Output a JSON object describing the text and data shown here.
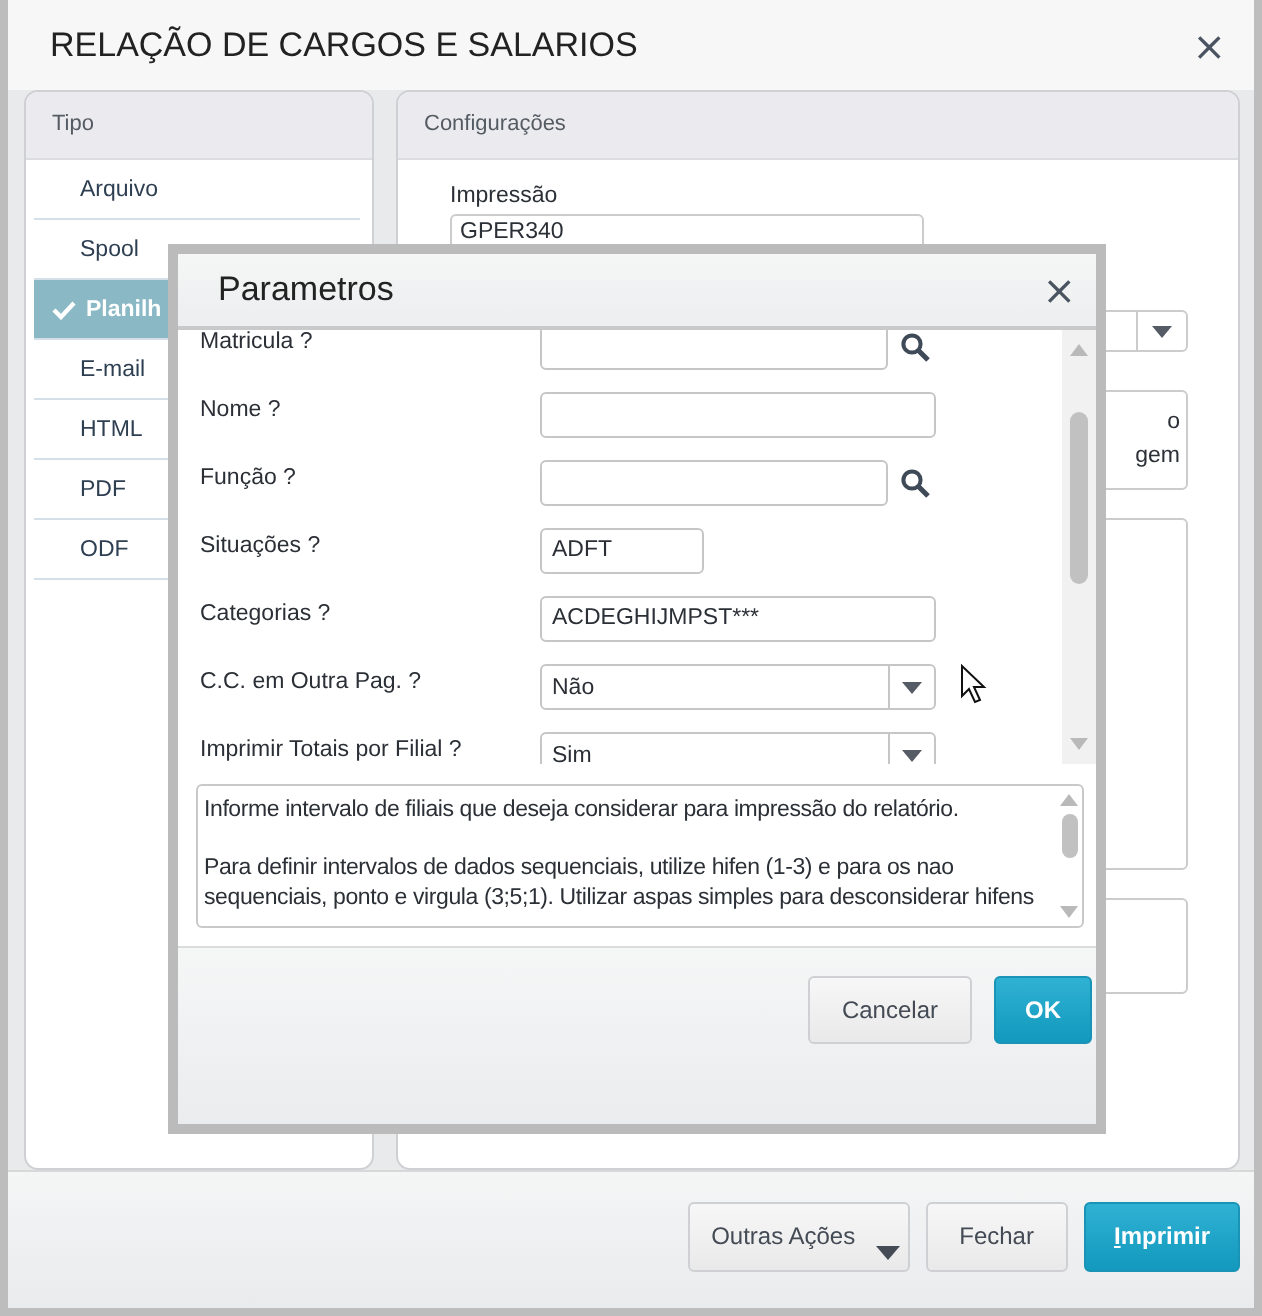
{
  "window": {
    "title": "RELAÇÃO DE CARGOS E SALARIOS",
    "close": "×"
  },
  "tipo_panel": {
    "title": "Tipo",
    "items": [
      {
        "label": "Arquivo",
        "selected": false
      },
      {
        "label": "Spool",
        "selected": false
      },
      {
        "label": "Planilh",
        "selected": true
      },
      {
        "label": "E-mail",
        "selected": false
      },
      {
        "label": "HTML",
        "selected": false
      },
      {
        "label": "PDF",
        "selected": false
      },
      {
        "label": "ODF",
        "selected": false
      }
    ]
  },
  "config_panel": {
    "title": "Configurações",
    "impressao_label": "Impressão",
    "impressao_value": "GPER340",
    "option_texts": [
      "o",
      "gem"
    ]
  },
  "dialog": {
    "title": "Parametros",
    "close": "×",
    "fields": [
      {
        "label": "Matricula ?",
        "kind": "lookup"
      },
      {
        "label": "Nome ?",
        "kind": "text"
      },
      {
        "label": "Função ?",
        "kind": "lookup"
      },
      {
        "label": "Situações ?",
        "kind": "short",
        "value": "ADFT"
      },
      {
        "label": "Categorias ?",
        "kind": "text",
        "value": "ACDEGHIJMPST***"
      },
      {
        "label": "C.C. em Outra Pag. ?",
        "kind": "select",
        "value": "Não"
      },
      {
        "label": "Imprimir Totais por Filial ?",
        "kind": "select",
        "value": "Sim"
      }
    ],
    "help_text": [
      "Informe intervalo de filiais que deseja considerar para impressão do relatório.",
      "Para definir intervalos de dados sequenciais, utilize hifen (1-3) e para os nao sequenciais, ponto e virgula (3;5;1). Utilizar aspas simples para desconsiderar hifens"
    ],
    "buttons": [
      {
        "label": "Cancelar",
        "kind": "default"
      },
      {
        "label": "OK",
        "kind": "primary"
      }
    ]
  },
  "footer_buttons": [
    {
      "label": "Outras Ações",
      "kind": "menu"
    },
    {
      "label": "Fechar",
      "kind": "default"
    },
    {
      "label": "Imprimir",
      "kind": "primary",
      "mnemonic": true
    }
  ]
}
